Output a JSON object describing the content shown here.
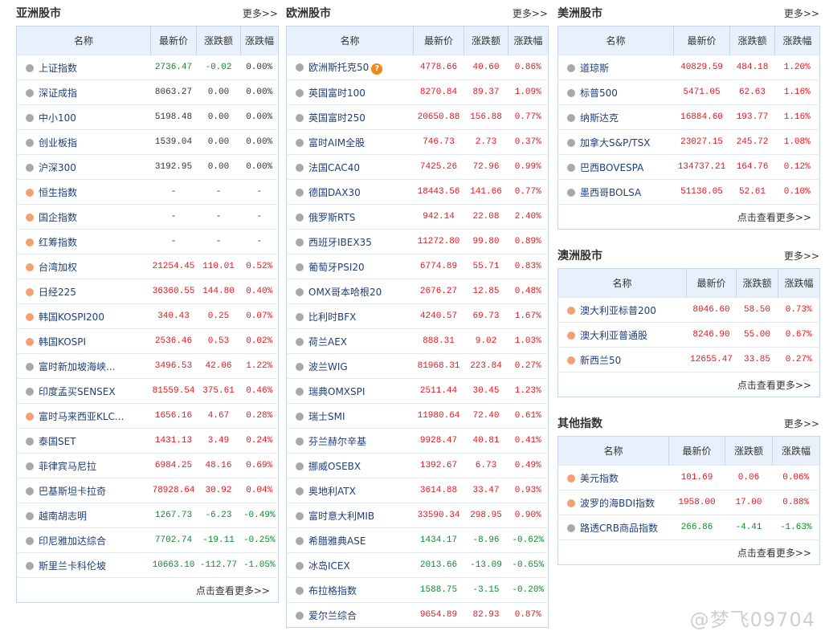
{
  "headers": [
    "名称",
    "最新价",
    "涨跌额",
    "涨跌幅"
  ],
  "panels": {
    "asia": {
      "title": "亚洲股市",
      "more": "更多>>",
      "footer": "点击查看更多>>",
      "rows": [
        {
          "name": "上证指数",
          "dot": "gray",
          "price": "2736.47",
          "change": "-0.02",
          "pct": "0.00%",
          "color": "green",
          "pct_color": "flat"
        },
        {
          "name": "深证成指",
          "dot": "gray",
          "price": "8063.27",
          "change": "0.00",
          "pct": "0.00%",
          "color": "flat",
          "pct_color": "flat"
        },
        {
          "name": "中小100",
          "dot": "gray",
          "price": "5198.48",
          "change": "0.00",
          "pct": "0.00%",
          "color": "flat",
          "pct_color": "flat"
        },
        {
          "name": "创业板指",
          "dot": "gray",
          "price": "1539.04",
          "change": "0.00",
          "pct": "0.00%",
          "color": "flat",
          "pct_color": "flat"
        },
        {
          "name": "沪深300",
          "dot": "gray",
          "price": "3192.95",
          "change": "0.00",
          "pct": "0.00%",
          "color": "flat",
          "pct_color": "flat"
        },
        {
          "name": "恒生指数",
          "dot": "orange",
          "price": "-",
          "change": "-",
          "pct": "-",
          "color": "flat",
          "pct_color": "flat"
        },
        {
          "name": "国企指数",
          "dot": "orange",
          "price": "-",
          "change": "-",
          "pct": "-",
          "color": "flat",
          "pct_color": "flat"
        },
        {
          "name": "红筹指数",
          "dot": "orange",
          "price": "-",
          "change": "-",
          "pct": "-",
          "color": "flat",
          "pct_color": "flat"
        },
        {
          "name": "台湾加权",
          "dot": "orange",
          "price": "21254.45",
          "change": "110.01",
          "pct": "0.52%",
          "color": "red",
          "pct_color": "red"
        },
        {
          "name": "日经225",
          "dot": "orange",
          "price": "36360.55",
          "change": "144.80",
          "pct": "0.40%",
          "color": "red",
          "pct_color": "red"
        },
        {
          "name": "韩国KOSPI200",
          "dot": "orange",
          "price": "340.43",
          "change": "0.25",
          "pct": "0.07%",
          "color": "red",
          "pct_color": "red"
        },
        {
          "name": "韩国KOSPI",
          "dot": "orange",
          "price": "2536.46",
          "change": "0.53",
          "pct": "0.02%",
          "color": "red",
          "pct_color": "red"
        },
        {
          "name": "富时新加坡海峡...",
          "dot": "gray",
          "price": "3496.53",
          "change": "42.06",
          "pct": "1.22%",
          "color": "red",
          "pct_color": "red"
        },
        {
          "name": "印度孟买SENSEX",
          "dot": "gray",
          "price": "81559.54",
          "change": "375.61",
          "pct": "0.46%",
          "color": "red",
          "pct_color": "red"
        },
        {
          "name": "富时马来西亚KLC...",
          "dot": "orange",
          "price": "1656.16",
          "change": "4.67",
          "pct": "0.28%",
          "color": "red",
          "pct_color": "red"
        },
        {
          "name": "泰国SET",
          "dot": "gray",
          "price": "1431.13",
          "change": "3.49",
          "pct": "0.24%",
          "color": "red",
          "pct_color": "red"
        },
        {
          "name": "菲律宾马尼拉",
          "dot": "gray",
          "price": "6984.25",
          "change": "48.16",
          "pct": "0.69%",
          "color": "red",
          "pct_color": "red"
        },
        {
          "name": "巴基斯坦卡拉奇",
          "dot": "gray",
          "price": "78928.64",
          "change": "30.92",
          "pct": "0.04%",
          "color": "red",
          "pct_color": "red"
        },
        {
          "name": "越南胡志明",
          "dot": "gray",
          "price": "1267.73",
          "change": "-6.23",
          "pct": "-0.49%",
          "color": "green",
          "pct_color": "green"
        },
        {
          "name": "印尼雅加达综合",
          "dot": "gray",
          "price": "7702.74",
          "change": "-19.11",
          "pct": "-0.25%",
          "color": "green",
          "pct_color": "green"
        },
        {
          "name": "斯里兰卡科伦坡",
          "dot": "gray",
          "price": "10663.10",
          "change": "-112.77",
          "pct": "-1.05%",
          "color": "green",
          "pct_color": "green"
        }
      ]
    },
    "europe": {
      "title": "欧洲股市",
      "more": "更多>>",
      "help": "?",
      "rows": [
        {
          "name": "欧洲斯托克50",
          "dot": "gray",
          "price": "4778.66",
          "change": "40.60",
          "pct": "0.86%",
          "color": "red",
          "pct_color": "red",
          "help": true
        },
        {
          "name": "英国富时100",
          "dot": "gray",
          "price": "8270.84",
          "change": "89.37",
          "pct": "1.09%",
          "color": "red",
          "pct_color": "red"
        },
        {
          "name": "英国富时250",
          "dot": "gray",
          "price": "20650.88",
          "change": "156.88",
          "pct": "0.77%",
          "color": "red",
          "pct_color": "red"
        },
        {
          "name": "富时AIM全股",
          "dot": "gray",
          "price": "746.73",
          "change": "2.73",
          "pct": "0.37%",
          "color": "red",
          "pct_color": "red"
        },
        {
          "name": "法国CAC40",
          "dot": "gray",
          "price": "7425.26",
          "change": "72.96",
          "pct": "0.99%",
          "color": "red",
          "pct_color": "red"
        },
        {
          "name": "德国DAX30",
          "dot": "gray",
          "price": "18443.56",
          "change": "141.66",
          "pct": "0.77%",
          "color": "red",
          "pct_color": "red"
        },
        {
          "name": "俄罗斯RTS",
          "dot": "gray",
          "price": "942.14",
          "change": "22.08",
          "pct": "2.40%",
          "color": "red",
          "pct_color": "red"
        },
        {
          "name": "西班牙IBEX35",
          "dot": "gray",
          "price": "11272.80",
          "change": "99.80",
          "pct": "0.89%",
          "color": "red",
          "pct_color": "red"
        },
        {
          "name": "葡萄牙PSI20",
          "dot": "gray",
          "price": "6774.89",
          "change": "55.71",
          "pct": "0.83%",
          "color": "red",
          "pct_color": "red"
        },
        {
          "name": "OMX哥本哈根20",
          "dot": "gray",
          "price": "2676.27",
          "change": "12.85",
          "pct": "0.48%",
          "color": "red",
          "pct_color": "red"
        },
        {
          "name": "比利时BFX",
          "dot": "gray",
          "price": "4240.57",
          "change": "69.73",
          "pct": "1.67%",
          "color": "red",
          "pct_color": "red"
        },
        {
          "name": "荷兰AEX",
          "dot": "gray",
          "price": "888.31",
          "change": "9.02",
          "pct": "1.03%",
          "color": "red",
          "pct_color": "red"
        },
        {
          "name": "波兰WIG",
          "dot": "gray",
          "price": "81968.31",
          "change": "223.84",
          "pct": "0.27%",
          "color": "red",
          "pct_color": "red"
        },
        {
          "name": "瑞典OMXSPI",
          "dot": "gray",
          "price": "2511.44",
          "change": "30.45",
          "pct": "1.23%",
          "color": "red",
          "pct_color": "red"
        },
        {
          "name": "瑞士SMI",
          "dot": "gray",
          "price": "11980.64",
          "change": "72.40",
          "pct": "0.61%",
          "color": "red",
          "pct_color": "red"
        },
        {
          "name": "芬兰赫尔辛基",
          "dot": "gray",
          "price": "9928.47",
          "change": "40.81",
          "pct": "0.41%",
          "color": "red",
          "pct_color": "red"
        },
        {
          "name": "挪威OSEBX",
          "dot": "gray",
          "price": "1392.67",
          "change": "6.73",
          "pct": "0.49%",
          "color": "red",
          "pct_color": "red"
        },
        {
          "name": "奥地利ATX",
          "dot": "gray",
          "price": "3614.88",
          "change": "33.47",
          "pct": "0.93%",
          "color": "red",
          "pct_color": "red"
        },
        {
          "name": "富时意大利MIB",
          "dot": "gray",
          "price": "33590.34",
          "change": "298.95",
          "pct": "0.90%",
          "color": "red",
          "pct_color": "red"
        },
        {
          "name": "希腊雅典ASE",
          "dot": "gray",
          "price": "1434.17",
          "change": "-8.96",
          "pct": "-0.62%",
          "color": "green",
          "pct_color": "green"
        },
        {
          "name": "冰岛ICEX",
          "dot": "gray",
          "price": "2013.66",
          "change": "-13.09",
          "pct": "-0.65%",
          "color": "green",
          "pct_color": "green"
        },
        {
          "name": "布拉格指数",
          "dot": "gray",
          "price": "1588.75",
          "change": "-3.15",
          "pct": "-0.20%",
          "color": "green",
          "pct_color": "green"
        },
        {
          "name": "爱尔兰综合",
          "dot": "gray",
          "price": "9654.89",
          "change": "82.93",
          "pct": "0.87%",
          "color": "red",
          "pct_color": "red"
        }
      ]
    },
    "america": {
      "title": "美洲股市",
      "more": "更多>>",
      "footer": "点击查看更多>>",
      "rows": [
        {
          "name": "道琼斯",
          "dot": "gray",
          "price": "40829.59",
          "change": "484.18",
          "pct": "1.20%",
          "color": "red",
          "pct_color": "red"
        },
        {
          "name": "标普500",
          "dot": "gray",
          "price": "5471.05",
          "change": "62.63",
          "pct": "1.16%",
          "color": "red",
          "pct_color": "red"
        },
        {
          "name": "纳斯达克",
          "dot": "gray",
          "price": "16884.60",
          "change": "193.77",
          "pct": "1.16%",
          "color": "red",
          "pct_color": "red"
        },
        {
          "name": "加拿大S&P/TSX",
          "dot": "gray",
          "price": "23027.15",
          "change": "245.72",
          "pct": "1.08%",
          "color": "red",
          "pct_color": "red"
        },
        {
          "name": "巴西BOVESPA",
          "dot": "gray",
          "price": "134737.21",
          "change": "164.76",
          "pct": "0.12%",
          "color": "red",
          "pct_color": "red"
        },
        {
          "name": "墨西哥BOLSA",
          "dot": "gray",
          "price": "51136.05",
          "change": "52.61",
          "pct": "0.10%",
          "color": "red",
          "pct_color": "red"
        }
      ]
    },
    "australia": {
      "title": "澳洲股市",
      "more": "更多>>",
      "footer": "点击查看更多>>",
      "rows": [
        {
          "name": "澳大利亚标普200",
          "dot": "orange",
          "price": "8046.60",
          "change": "58.50",
          "pct": "0.73%",
          "color": "red",
          "pct_color": "red"
        },
        {
          "name": "澳大利亚普通股",
          "dot": "orange",
          "price": "8246.90",
          "change": "55.00",
          "pct": "0.67%",
          "color": "red",
          "pct_color": "red"
        },
        {
          "name": "新西兰50",
          "dot": "orange",
          "price": "12655.47",
          "change": "33.85",
          "pct": "0.27%",
          "color": "red",
          "pct_color": "red"
        }
      ]
    },
    "other": {
      "title": "其他指数",
      "more": "更多>>",
      "footer": "点击查看更多>>",
      "rows": [
        {
          "name": "美元指数",
          "dot": "orange",
          "price": "101.69",
          "change": "0.06",
          "pct": "0.06%",
          "color": "red",
          "pct_color": "red"
        },
        {
          "name": "波罗的海BDI指数",
          "dot": "orange",
          "price": "1958.00",
          "change": "17.00",
          "pct": "0.88%",
          "color": "red",
          "pct_color": "red"
        },
        {
          "name": "路透CRB商品指数",
          "dot": "gray",
          "price": "266.86",
          "change": "-4.41",
          "pct": "-1.63%",
          "color": "green",
          "pct_color": "green"
        }
      ]
    }
  },
  "watermark": "@梦飞09704",
  "colors": {
    "up": "#e8151c",
    "down": "#0d8a2b",
    "header_bg": "#e8f1fb",
    "border": "#c5d6ea"
  }
}
